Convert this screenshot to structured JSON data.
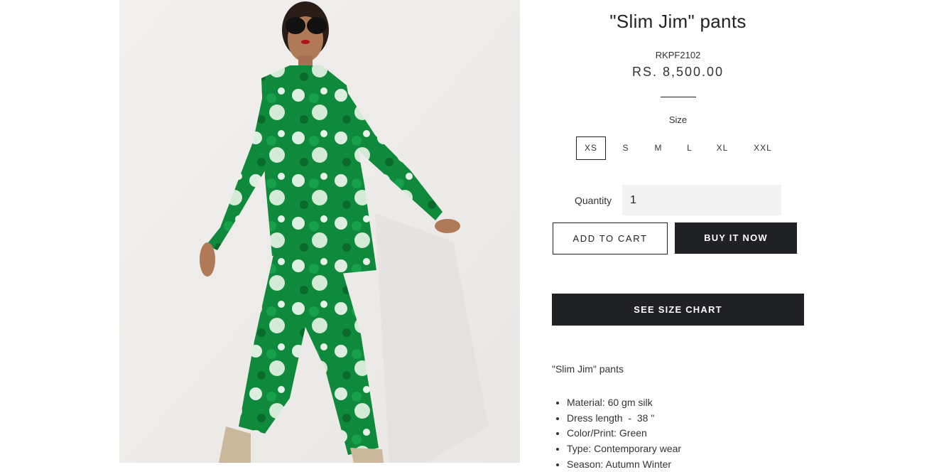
{
  "product": {
    "image_alt": "Model wearing green floral print silk shirt and pants",
    "title": "\"Slim Jim\" pants",
    "sku": "RKPF2102",
    "price": "RS. 8,500.00"
  },
  "size_selector": {
    "label": "Size",
    "options": [
      "XS",
      "S",
      "M",
      "L",
      "XL",
      "XXL"
    ],
    "selected": "XS"
  },
  "quantity": {
    "label": "Quantity",
    "value": "1"
  },
  "actions": {
    "add_to_cart": "ADD TO CART",
    "buy_now": "BUY IT NOW",
    "size_chart": "SEE SIZE CHART"
  },
  "description": {
    "title": "\"Slim Jim\" pants",
    "features": [
      "Material: 60 gm silk",
      "Dress length  -  38 \"",
      "Color/Print: Green",
      "Type: Contemporary wear",
      "Season: Autumn Winter"
    ]
  },
  "colors": {
    "primary_dark": "#202124",
    "input_bg": "#f3f3f3",
    "print_green": "#0f8a3c"
  }
}
